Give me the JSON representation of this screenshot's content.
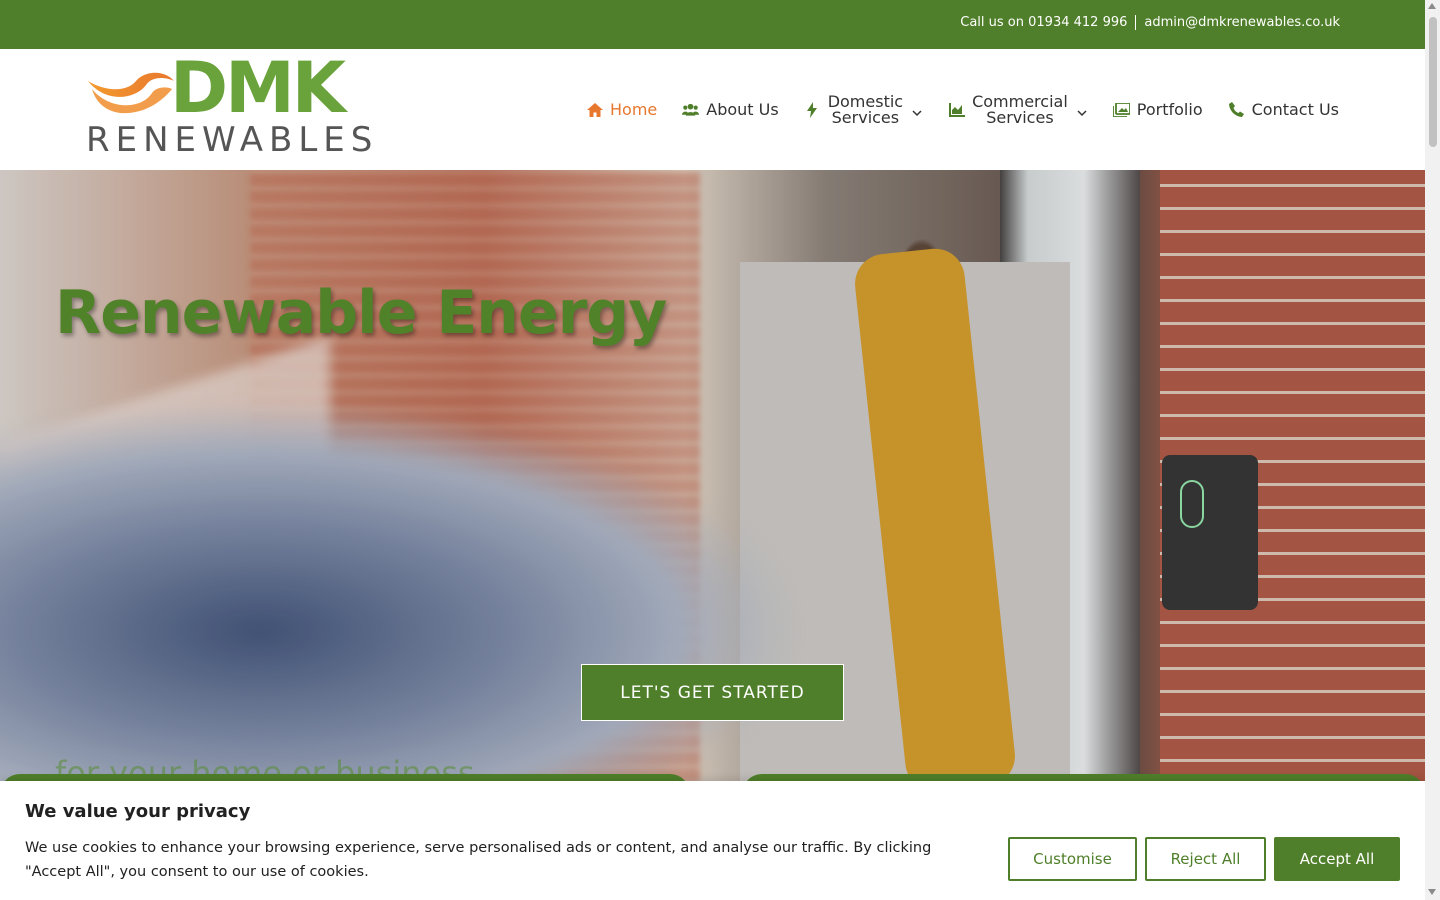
{
  "topbar": {
    "phone_text": "Call us on 01934 412 996",
    "email_text": "admin@dmkrenewables.co.uk"
  },
  "logo": {
    "primary": "DMK",
    "secondary": "RENEWABLES"
  },
  "nav": {
    "home": "Home",
    "about": "About Us",
    "domestic_line1": "Domestic",
    "domestic_line2": "Services",
    "commercial_line1": "Commercial",
    "commercial_line2": "Services",
    "portfolio": "Portfolio",
    "contact": "Contact Us"
  },
  "hero": {
    "title": "Renewable Energy",
    "subtitle": "for your home or business",
    "cta_label": "LET'S GET STARTED"
  },
  "cookie": {
    "title": "We value your privacy",
    "body": "We use cookies to enhance your browsing experience, serve personalised ads or content, and analyse our traffic. By clicking \"Accept All\", you consent to our use of cookies.",
    "customise_label": "Customise",
    "reject_label": "Reject All",
    "accept_label": "Accept All"
  },
  "colors": {
    "brand_green": "#4f7f2a",
    "accent_orange": "#e8772e",
    "logo_green": "#6aa33b"
  },
  "icons": {
    "home": "home-icon",
    "about": "users-icon",
    "domestic": "bolt-icon",
    "commercial": "chart-icon",
    "portfolio": "images-icon",
    "contact": "phone-icon"
  }
}
